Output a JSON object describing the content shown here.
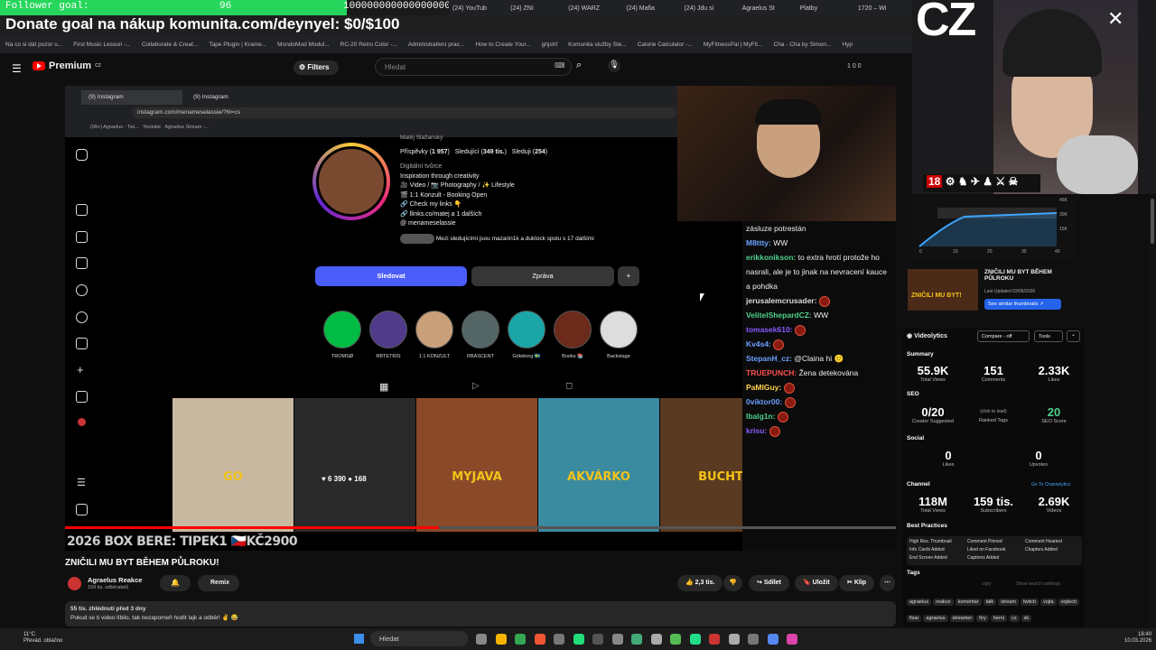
{
  "goal": {
    "label": "Follower goal:",
    "current": "96",
    "target": "1000000000000000000",
    "fraction": 0.38
  },
  "donate": "Donate goal na nákup komunita.com/deynyel: $0/$100",
  "browser_tabs": [
    "(24) YouTub",
    "(24) ZNI",
    "(24) WARZ",
    "(24) Mafia",
    "(24) Jdu si",
    "Agraelus St",
    "Platby",
    "1720 – Wi"
  ],
  "bookmarks": [
    "Na co si dát pozor u...",
    "First Music Lesson -...",
    "Collaborate & Creat...",
    "Tape Plugin | Krame...",
    "MondoMod Modul...",
    "RC-20 Retro Color -...",
    "Administrativní prac...",
    "How to Create Your...",
    "ghjshf",
    "Komunita služby Ste...",
    "Calorie Calculator -...",
    "MyFitnessPal | MyFit...",
    "Cha - Cha by Simon...",
    "Hyp"
  ],
  "youtube": {
    "logo": "Premium",
    "region": "CZ",
    "filters": "Filters",
    "search_placeholder": "Hledat",
    "counters": "1  0  0"
  },
  "inner_browser": {
    "tab1": "(9) Instagram",
    "tab2": "(9) Instagram",
    "url": "instagram.com/menameselassie/?hl=cs",
    "bm1": "(99+) Agraelus - Twi...",
    "bm2": "Youtube",
    "bm3": "Agraelus Stream -..."
  },
  "profile": {
    "name": "Matěj Slažanský",
    "posts": "1 957",
    "posts_label": "Příspěvky",
    "followers": "349 tis.",
    "followers_label": "Sledující",
    "following": "254",
    "following_label": "Sleduji",
    "category": "Digitální tvůrce",
    "bio": [
      "Inspiration through creativity",
      "🎥 Video / 📷 Photography / ✨ Lifestyle",
      "🎬 1:1 Konzult - Booking Open",
      "🔗 Check my links 👇",
      "🔗 llinks.co/matej a 1 dalších",
      "@ menameselassie"
    ],
    "mutual": "Mezi sledujícími jsou mazarin1k a duklock spolu s 17 dalšími",
    "follow": "Sledovat",
    "message": "Zpráva"
  },
  "highlights": [
    "TROMSØ",
    "RBTETRIS",
    "1:1 KONZULT",
    "RBASCENT",
    "Göteborg 🇸🇪",
    "Books 📚",
    "Backstage"
  ],
  "tiles": [
    {
      "text": "GO",
      "likes": "",
      "comments": ""
    },
    {
      "text": "",
      "likes": "6 390",
      "comments": "168"
    },
    {
      "text": "MYJAVA",
      "likes": "",
      "comments": ""
    },
    {
      "text": "AKVÁRKO",
      "likes": "",
      "comments": ""
    },
    {
      "text": "BUCHT",
      "likes": "",
      "comments": ""
    }
  ],
  "chat": [
    {
      "user": "",
      "color": "#eee",
      "text": "zásluze potrestán"
    },
    {
      "user": "M8ttty:",
      "color": "#6aa0ff",
      "text": "WW"
    },
    {
      "user": "erikkonikson:",
      "color": "#4fd18b",
      "text": "to extra hrotí protože ho nasrali, ale je to jinak na nevracení kauce a pohdka"
    },
    {
      "user": "jerusalemcrusader:",
      "color": "#dddddd",
      "text": ""
    },
    {
      "user": "VelitelShepardCZ:",
      "color": "#4fd18b",
      "text": "WW"
    },
    {
      "user": "tomasek610:",
      "color": "#8a5cff",
      "text": ""
    },
    {
      "user": "Kv4s4:",
      "color": "#6aa0ff",
      "text": ""
    },
    {
      "user": "StepanH_cz:",
      "color": "#6aa0ff",
      "text": "@Claina hi 🙂"
    },
    {
      "user": "TRUEPUNCH:",
      "color": "#ff4f4f",
      "text": "Žena detekována"
    },
    {
      "user": "PaMIGuy:",
      "color": "#ffd24f",
      "text": ""
    },
    {
      "user": "0viktor00:",
      "color": "#6aa0ff",
      "text": ""
    },
    {
      "user": "Ibalg1n:",
      "color": "#4fd18b",
      "text": ""
    },
    {
      "user": "krisu:",
      "color": "#8a5cff",
      "text": ""
    }
  ],
  "video": {
    "overlay": "2026 BOX BERE: TIPEK1 🇨🇿KČ2900",
    "progress": 0.45,
    "title": "ZNIČILI MU BYT BĚHEM PŮLROKU!",
    "channel": "Agraelus Reakce",
    "subs": "159 tis. odběratelů",
    "remix": "Remix",
    "likes": "2,3 tis.",
    "share": "Sdílet",
    "save": "Uložit",
    "clip": "Klip",
    "views": "55 tis. zhlédnutí  před 3 dny",
    "desc": "Pokud se ti video líbilo, tak nezapomeň hodit lajk a odběr! ✌️ 😂"
  },
  "cz_logo": "CZ",
  "badge18": "18",
  "similar": {
    "thumb": "ZNIČILI MU BYT!",
    "title": "ZNIČILI MU BYT BĚHEM PŮLROKU",
    "updated": "Last Updated 03/06/2026",
    "btn": "See similar thumbnails ↗"
  },
  "chart_axis": {
    "y": [
      "45K",
      "30K",
      "15K"
    ],
    "x": [
      "0",
      "10",
      "20",
      "30",
      "40"
    ]
  },
  "videolytics": {
    "brand": "Videolytics",
    "compare": "Compare - off",
    "tools": "Tools",
    "summary": "Summary",
    "views": "55.9K",
    "views_l": "Total Views",
    "comments": "151",
    "comments_l": "Comments",
    "likes": "2.33K",
    "likes_l": "Likes",
    "seo": "SEO",
    "creator": "0/20",
    "creator_l": "Creator Suggested",
    "ranked": "(click to load)",
    "ranked_l": "Ranked Tags",
    "score": "20",
    "score_l": "SEO Score",
    "social": "Social",
    "s_likes": "0",
    "s_likes_l": "Likes",
    "s_up": "0",
    "s_up_l": "Upvotes",
    "channel": "Channel",
    "channel_link": "Go To Channelytics",
    "c_views": "118M",
    "c_views_l": "Total Views",
    "c_subs": "159 tis.",
    "c_subs_l": "Subscribers",
    "c_videos": "2.69K",
    "c_videos_l": "Videos",
    "best": "Best Practices",
    "practices": [
      "High Res. Thumbnail",
      "Comment Pinned",
      "Comment Hearted",
      "Info Cards Added",
      "Liked on Facebook",
      "Chapters Added",
      "End Screen Added",
      "Captions Added"
    ],
    "tags_title": "Tags",
    "copy": "copy",
    "show": "Show search rankings",
    "tags": [
      "agraelus",
      "reakce",
      "komentar",
      "talk",
      "stream",
      "twitch",
      "vojta",
      "vojtech",
      "fisar",
      "agraelus",
      "streamer",
      "hry",
      "herni",
      "cz",
      "sk"
    ]
  },
  "taskbar": {
    "search": "Hledat",
    "temp": "11°C",
    "weather": "Převád. oblačno",
    "time": "18:40",
    "date": "10.03.2026"
  }
}
